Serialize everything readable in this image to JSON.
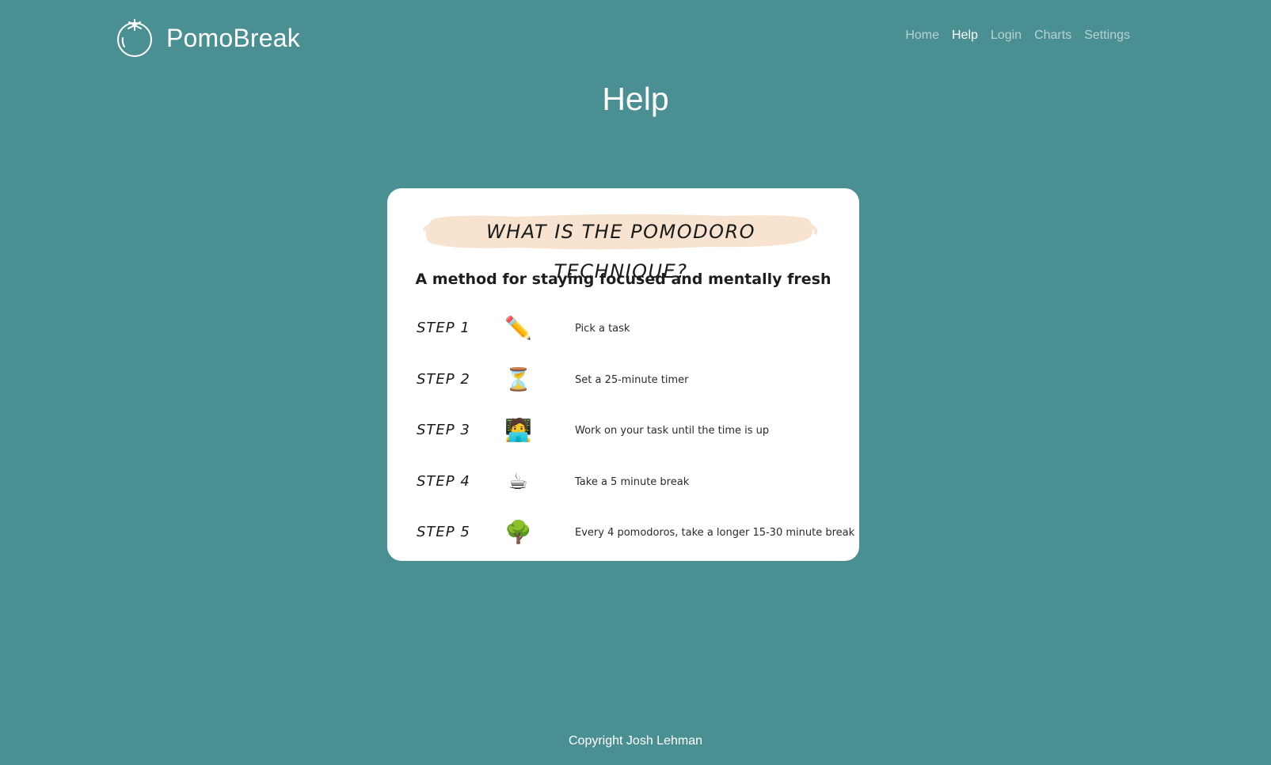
{
  "brand": {
    "name": "PomoBreak",
    "logo_icon": "tomato-icon"
  },
  "nav": {
    "items": [
      {
        "label": "Home",
        "active": false
      },
      {
        "label": "Help",
        "active": true
      },
      {
        "label": "Login",
        "active": false
      },
      {
        "label": "Charts",
        "active": false
      },
      {
        "label": "Settings",
        "active": false
      }
    ]
  },
  "page": {
    "title": "Help"
  },
  "infographic": {
    "banner_title": "WHAT IS THE POMODORO TECHNIQUE?",
    "subtitle": "A method for staying focused and mentally fresh",
    "steps": [
      {
        "label": "STEP 1",
        "icon": "pencil-icon",
        "glyph": "✏️",
        "description": "Pick a task"
      },
      {
        "label": "STEP 2",
        "icon": "hourglass-icon",
        "glyph": "⏳",
        "description": "Set a 25-minute timer"
      },
      {
        "label": "STEP 3",
        "icon": "person-laptop-icon",
        "glyph": "🧑‍💻",
        "description": "Work on your task until the time is up"
      },
      {
        "label": "STEP 4",
        "icon": "coffee-icon",
        "glyph": "☕",
        "description": "Take a 5 minute break"
      },
      {
        "label": "STEP 5",
        "icon": "tree-icon",
        "glyph": "🌳",
        "description": "Every 4 pomodoros, take a longer 15-30 minute break"
      }
    ],
    "banner_color": "#f7e3cf"
  },
  "footer": {
    "text": "Copyright Josh Lehman"
  },
  "colors": {
    "background": "#4a8f92",
    "card": "#ffffff",
    "nav_inactive": "rgba(255,255,255,0.6)",
    "nav_active": "#ffffff"
  }
}
